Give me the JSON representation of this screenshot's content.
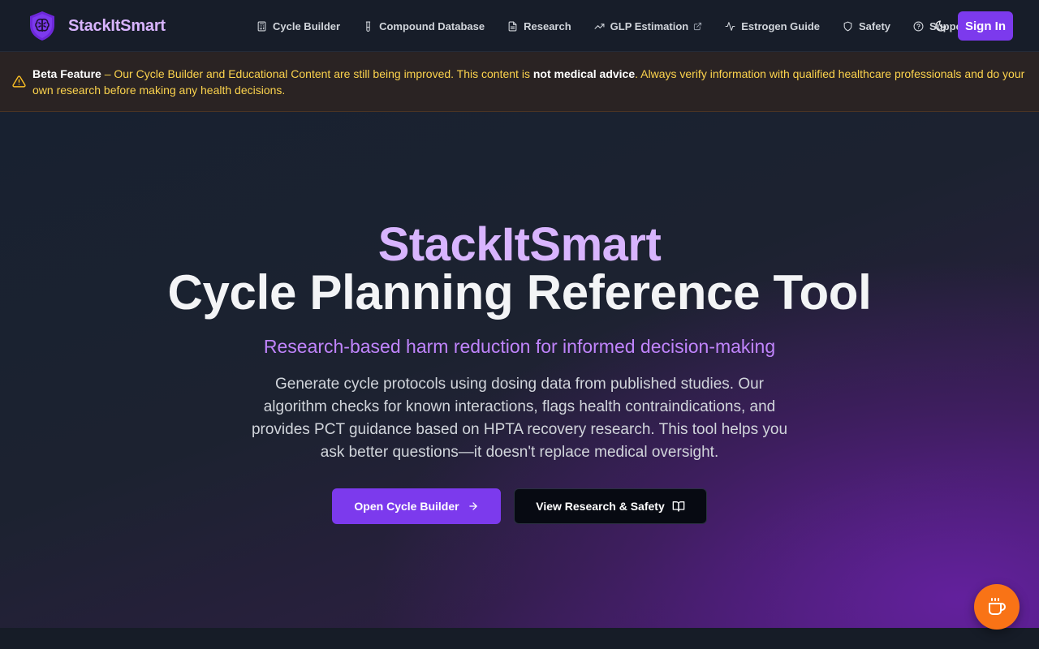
{
  "app": {
    "brand_name": "StackItSmart",
    "accent_color": "#7c3aed",
    "brand_color": "#d8b4fe"
  },
  "nav": {
    "items": [
      {
        "label": "Cycle Builder",
        "icon": "calculator-icon"
      },
      {
        "label": "Compound Database",
        "icon": "vial-icon"
      },
      {
        "label": "Research",
        "icon": "document-icon"
      },
      {
        "label": "GLP Estimation",
        "icon": "trending-up-icon",
        "external": true
      },
      {
        "label": "Estrogen Guide",
        "icon": "activity-icon"
      },
      {
        "label": "Safety",
        "icon": "shield-icon"
      },
      {
        "label": "Support",
        "icon": "help-circle-icon"
      }
    ],
    "theme_icon": "moon-icon",
    "signin_label": "Sign In"
  },
  "banner": {
    "title": "Beta Feature",
    "text_before": " – Our Cycle Builder and Educational Content are still being improved. This content is ",
    "emphasis": "not medical advice",
    "text_after": ". Always verify information with qualified healthcare professionals and do your own research before making any health decisions.",
    "icon": "warning-triangle-icon",
    "color": "#fcd34d"
  },
  "hero": {
    "brand": "StackItSmart",
    "title": "Cycle Planning Reference Tool",
    "tagline": "Research-based harm reduction for informed decision-making",
    "description": "Generate cycle protocols using dosing data from published studies. Our algorithm checks for known interactions, flags health contraindications, and provides PCT guidance based on HPTA recovery research. This tool helps you ask better questions—it doesn't replace medical oversight.",
    "primary_button": "Open Cycle Builder",
    "secondary_button": "View Research & Safety"
  },
  "fab": {
    "icon": "coffee-cup-icon",
    "color": "#f97316"
  }
}
